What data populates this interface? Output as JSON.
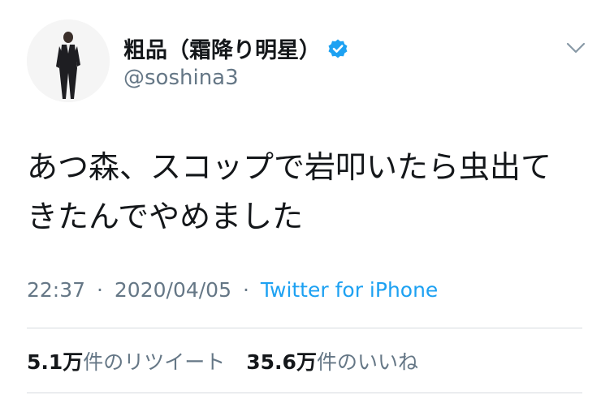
{
  "user": {
    "display_name": "粗品（霜降り明星）",
    "handle": "@soshina3",
    "verified": true
  },
  "tweet": {
    "text": "あつ森、スコップで岩叩いたら虫出てきたんでやめました"
  },
  "meta": {
    "time": "22:37",
    "separator": "·",
    "date": "2020/04/05",
    "source": "Twitter for iPhone"
  },
  "stats": {
    "retweets_count": "5.1万",
    "retweets_label": "件のリツイート",
    "likes_count": "35.6万",
    "likes_label": "件のいいね"
  },
  "colors": {
    "text": "#14171a",
    "secondary": "#657786",
    "link": "#1da1f2",
    "divider": "#d6dbdf"
  },
  "icons": [
    "verified-badge-icon",
    "chevron-down-icon"
  ]
}
